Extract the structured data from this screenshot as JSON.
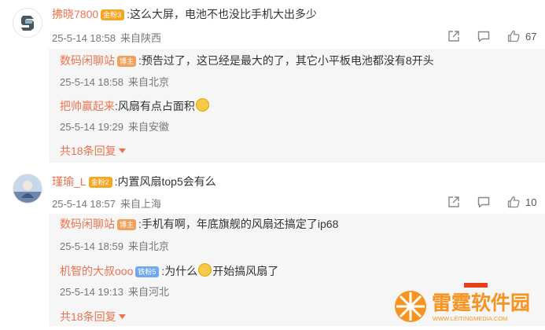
{
  "comments": [
    {
      "username": "拂晓7800",
      "badge": "金粉3",
      "text": ":这么大屏，电池不也没比手机大出多少",
      "date": "25-5-14 18:58",
      "location": "来自陕西",
      "likes": "67",
      "replies": [
        {
          "username": "数码闲聊站",
          "badge": "博主",
          "text": ":预告过了，这已经是最大的了，其它小平板电池都没有8开头",
          "date": "25-5-14 18:58",
          "location": "来自北京"
        },
        {
          "username": "把帅赢起来",
          "text": ":风扇有点占面积",
          "emoji": "sweat-emoji",
          "date": "25-5-14 19:29",
          "location": "来自安徽"
        }
      ],
      "more": "共18条回复"
    },
    {
      "username": "瑾瑜_L",
      "badge": "金粉2",
      "text": ":内置风扇top5会有么",
      "date": "25-5-14 18:57",
      "location": "来自上海",
      "likes": "10",
      "replies": [
        {
          "username": "数码闲聊站",
          "badge": "博主",
          "text": ":手机有啊，年底旗舰的风扇还搞定了ip68",
          "date": "25-5-14 18:59",
          "location": "来自北京"
        },
        {
          "username": "机智的大叔ooo",
          "badge": "铁粉5",
          "text_before": ":为什么",
          "emoji": "grin-emoji",
          "text_after": "开始搞风扇了",
          "date": "25-5-14 19:13",
          "location": "来自河北"
        }
      ],
      "more": "共18条回复"
    }
  ],
  "watermark": {
    "title": "雷霆软件园",
    "url": "WWW.LEITINGMEDIA.COM"
  },
  "colors": {
    "username": "#eb7350",
    "meta": "#777777",
    "sub_bg": "#f6f6f6",
    "gold_badge": "#f5a623",
    "blue_badge": "#6fa8ee",
    "host_badge": "#f0a05a"
  }
}
